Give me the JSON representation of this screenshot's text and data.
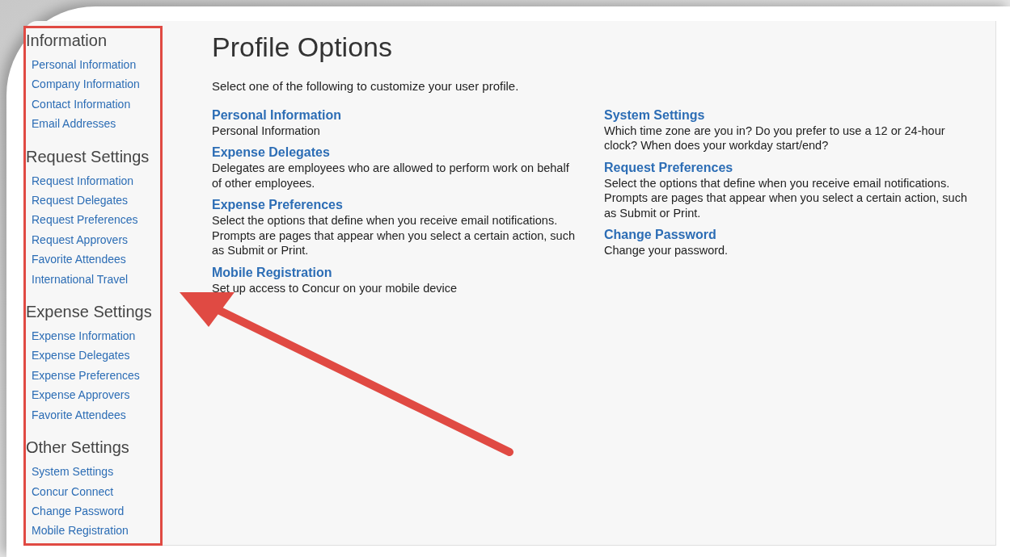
{
  "sidebar": {
    "sections": [
      {
        "heading": "Information",
        "items": [
          "Personal Information",
          "Company Information",
          "Contact Information",
          "Email Addresses"
        ]
      },
      {
        "heading": "Request Settings",
        "items": [
          "Request Information",
          "Request Delegates",
          "Request Preferences",
          "Request Approvers",
          "Favorite Attendees",
          "International Travel"
        ]
      },
      {
        "heading": "Expense Settings",
        "items": [
          "Expense Information",
          "Expense Delegates",
          "Expense Preferences",
          "Expense Approvers",
          "Favorite Attendees"
        ]
      },
      {
        "heading": "Other Settings",
        "items": [
          "System Settings",
          "Concur Connect",
          "Change Password",
          "Mobile Registration"
        ]
      }
    ]
  },
  "main": {
    "title": "Profile Options",
    "intro": "Select one of the following to customize your user profile.",
    "columns": [
      [
        {
          "title": "Personal Information",
          "description": "Personal Information"
        },
        {
          "title": "Expense Delegates",
          "description": "Delegates are employees who are allowed to perform work on behalf of other employees."
        },
        {
          "title": "Expense Preferences",
          "description": "Select the options that define when you receive email notifications. Prompts are pages that appear when you select a certain action, such as Submit or Print."
        },
        {
          "title": "Mobile Registration",
          "description": "Set up access to Concur on your mobile device"
        }
      ],
      [
        {
          "title": "System Settings",
          "description": "Which time zone are you in? Do you prefer to use a 12 or 24-hour clock? When does your workday start/end?"
        },
        {
          "title": "Request Preferences",
          "description": "Select the options that define when you receive email notifications. Prompts are pages that appear when you select a certain action, such as Submit or Print."
        },
        {
          "title": "Change Password",
          "description": "Change your password."
        }
      ]
    ]
  }
}
